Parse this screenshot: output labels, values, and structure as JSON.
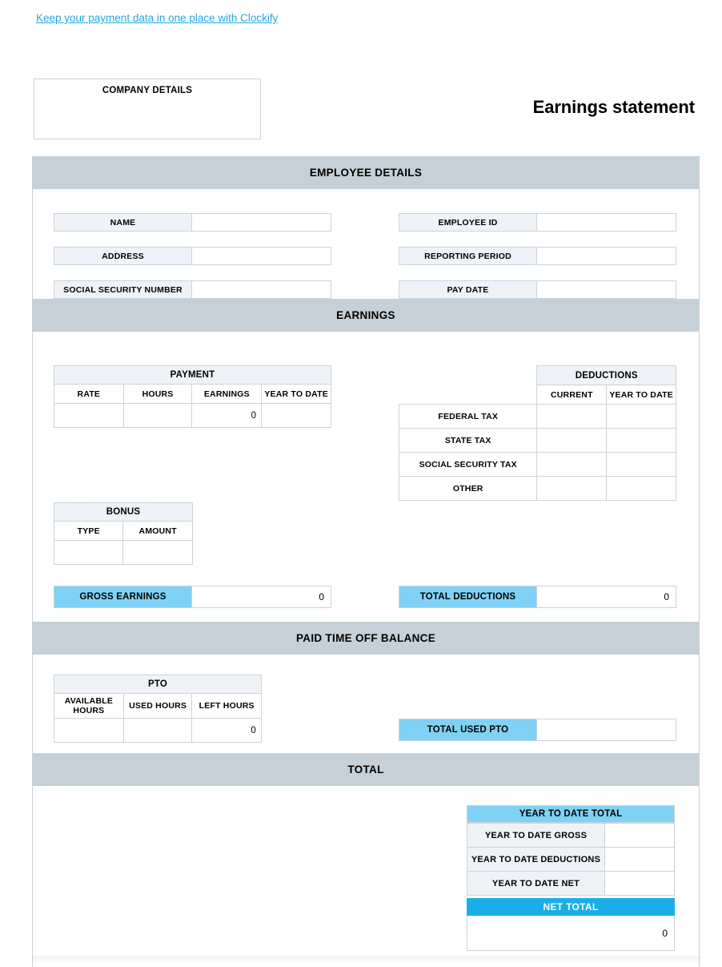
{
  "promo": {
    "link_text": "Keep your payment data in one place with Clockify",
    "link_color": "#22A7E8"
  },
  "header": {
    "company_box_label": "COMPANY DETAILS",
    "title": "Earnings statement"
  },
  "colors": {
    "band": "#C5D0D8",
    "label_cell": "#EFF3F7",
    "highlight_light": "#7FD2F5",
    "highlight_strong": "#19AEE8",
    "border": "#C9D3DB"
  },
  "sections": {
    "employee_details": {
      "band_title": "EMPLOYEE DETAILS",
      "left_fields": [
        {
          "label": "NAME",
          "value": ""
        },
        {
          "label": "ADDRESS",
          "value": ""
        },
        {
          "label": "SOCIAL SECURITY NUMBER",
          "value": ""
        }
      ],
      "right_fields": [
        {
          "label": "EMPLOYEE ID",
          "value": ""
        },
        {
          "label": "REPORTING PERIOD",
          "value": ""
        },
        {
          "label": "PAY DATE",
          "value": ""
        }
      ]
    },
    "earnings": {
      "band_title": "EARNINGS",
      "payment_table": {
        "caption": "PAYMENT",
        "columns": [
          "RATE",
          "HOURS",
          "EARNINGS",
          "YEAR TO DATE"
        ],
        "rows": [
          {
            "rate": "",
            "hours": "",
            "earnings": "0",
            "year_to_date": ""
          }
        ]
      },
      "bonus_table": {
        "caption": "BONUS",
        "columns": [
          "TYPE",
          "AMOUNT"
        ],
        "rows": [
          {
            "type": "",
            "amount": ""
          }
        ]
      },
      "deductions_table": {
        "caption": "DEDUCTIONS",
        "columns": [
          "CURRENT",
          "YEAR TO DATE"
        ],
        "rows": [
          {
            "label": "FEDERAL TAX",
            "current": "",
            "year_to_date": ""
          },
          {
            "label": "STATE TAX",
            "current": "",
            "year_to_date": ""
          },
          {
            "label": "SOCIAL SECURITY TAX",
            "current": "",
            "year_to_date": ""
          },
          {
            "label": "OTHER",
            "current": "",
            "year_to_date": ""
          }
        ]
      },
      "gross_earnings": {
        "label": "GROSS EARNINGS",
        "value": "0"
      },
      "total_deductions": {
        "label": "TOTAL DEDUCTIONS",
        "value": "0"
      }
    },
    "pto": {
      "band_title": "PAID TIME OFF BALANCE",
      "table": {
        "caption": "PTO",
        "columns": [
          "AVAILABLE HOURS",
          "USED HOURS",
          "LEFT HOURS"
        ],
        "rows": [
          {
            "available": "",
            "used": "",
            "left": "0"
          }
        ]
      },
      "total_used": {
        "label": "TOTAL USED PTO",
        "value": ""
      }
    },
    "total": {
      "band_title": "TOTAL",
      "ytd_block": {
        "header": "YEAR TO DATE TOTAL",
        "rows": [
          {
            "label": "YEAR TO DATE GROSS",
            "value": ""
          },
          {
            "label": "YEAR TO DATE DEDUCTIONS",
            "value": ""
          },
          {
            "label": "YEAR TO DATE NET",
            "value": ""
          }
        ]
      },
      "net_block": {
        "header": "NET TOTAL",
        "value": "0"
      }
    }
  }
}
